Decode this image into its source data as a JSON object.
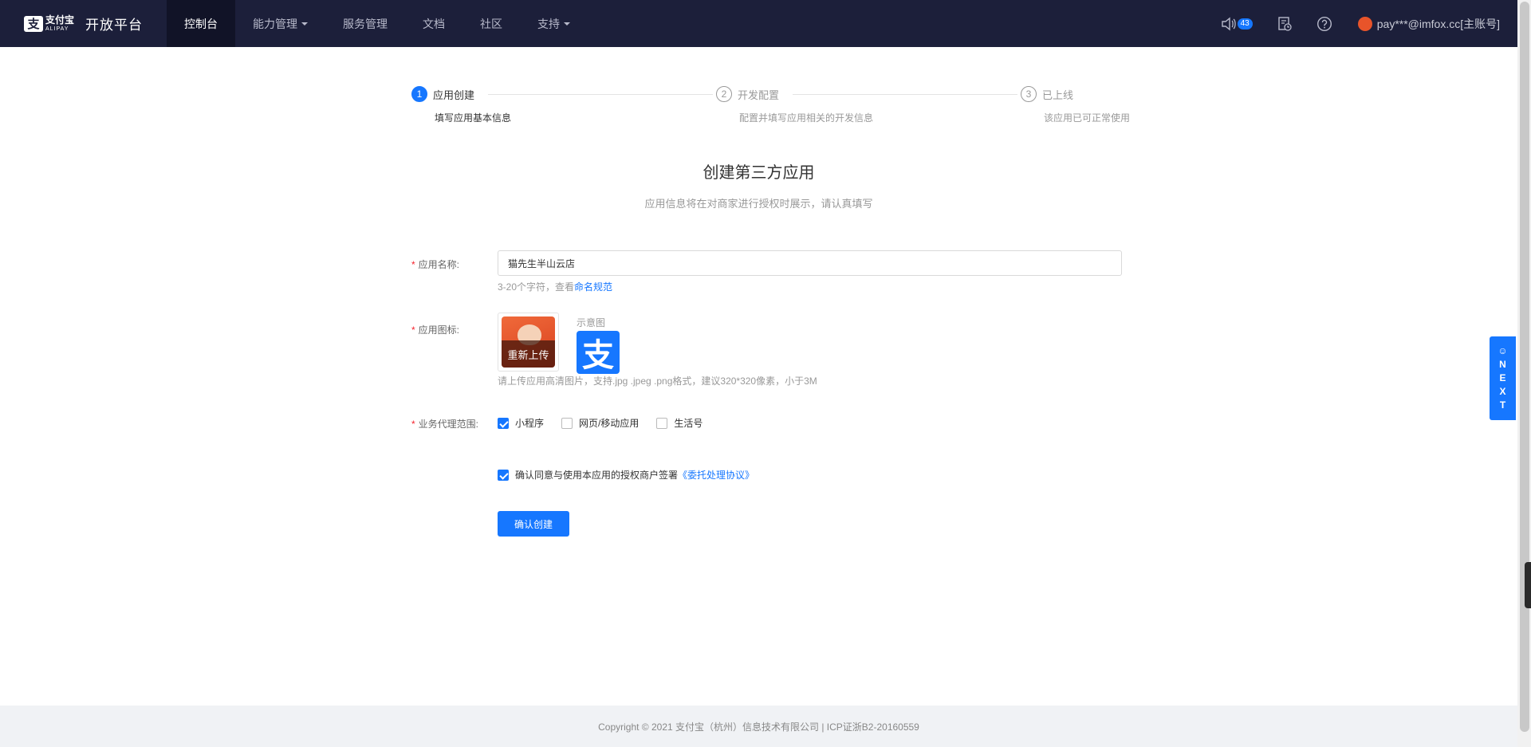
{
  "brand": {
    "logo_char": "支",
    "logo_cn": "支付宝",
    "logo_en": "ALIPAY",
    "title": "开放平台"
  },
  "nav": {
    "items": [
      {
        "label": "控制台",
        "active": true,
        "dropdown": false
      },
      {
        "label": "能力管理",
        "active": false,
        "dropdown": true
      },
      {
        "label": "服务管理",
        "active": false,
        "dropdown": false
      },
      {
        "label": "文档",
        "active": false,
        "dropdown": false
      },
      {
        "label": "社区",
        "active": false,
        "dropdown": false
      },
      {
        "label": "支持",
        "active": false,
        "dropdown": true
      }
    ],
    "notification_count": "43",
    "user": "pay***@imfox.cc[主账号]"
  },
  "steps": [
    {
      "num": "1",
      "title": "应用创建",
      "desc": "填写应用基本信息",
      "state": "active"
    },
    {
      "num": "2",
      "title": "开发配置",
      "desc": "配置并填写应用相关的开发信息",
      "state": "pending"
    },
    {
      "num": "3",
      "title": "已上线",
      "desc": "该应用已可正常使用",
      "state": "pending"
    }
  ],
  "page": {
    "title": "创建第三方应用",
    "subtitle": "应用信息将在对商家进行授权时展示，请认真填写"
  },
  "form": {
    "name_label": "应用名称:",
    "name_value": "猫先生半山云店",
    "name_hint": "3-20个字符，查看",
    "name_hint_link": "命名规范",
    "icon_label": "应用图标:",
    "reupload_label": "重新上传",
    "sample_label": "示意图",
    "sample_char": "支",
    "icon_hint": "请上传应用高清图片，支持.jpg .jpeg .png格式，建议320*320像素，小于3M",
    "scope_label": "业务代理范围:",
    "scope_options": [
      {
        "label": "小程序",
        "checked": true
      },
      {
        "label": "网页/移动应用",
        "checked": false
      },
      {
        "label": "生活号",
        "checked": false
      }
    ],
    "agree_text": "确认同意与使用本应用的授权商户签署",
    "agree_link": "《委托处理协议》",
    "agree_checked": true,
    "submit_label": "确认创建"
  },
  "footer": {
    "text": "Copyright © 2021 支付宝（杭州）信息技术有限公司  |  ICP证浙B2-20160559"
  },
  "float_tab": {
    "icon_char": "☺",
    "letters": [
      "N",
      "E",
      "X",
      "T"
    ]
  },
  "colors": {
    "nav_bg": "#1c1f3a",
    "primary": "#1677ff",
    "required": "#f5222d"
  }
}
